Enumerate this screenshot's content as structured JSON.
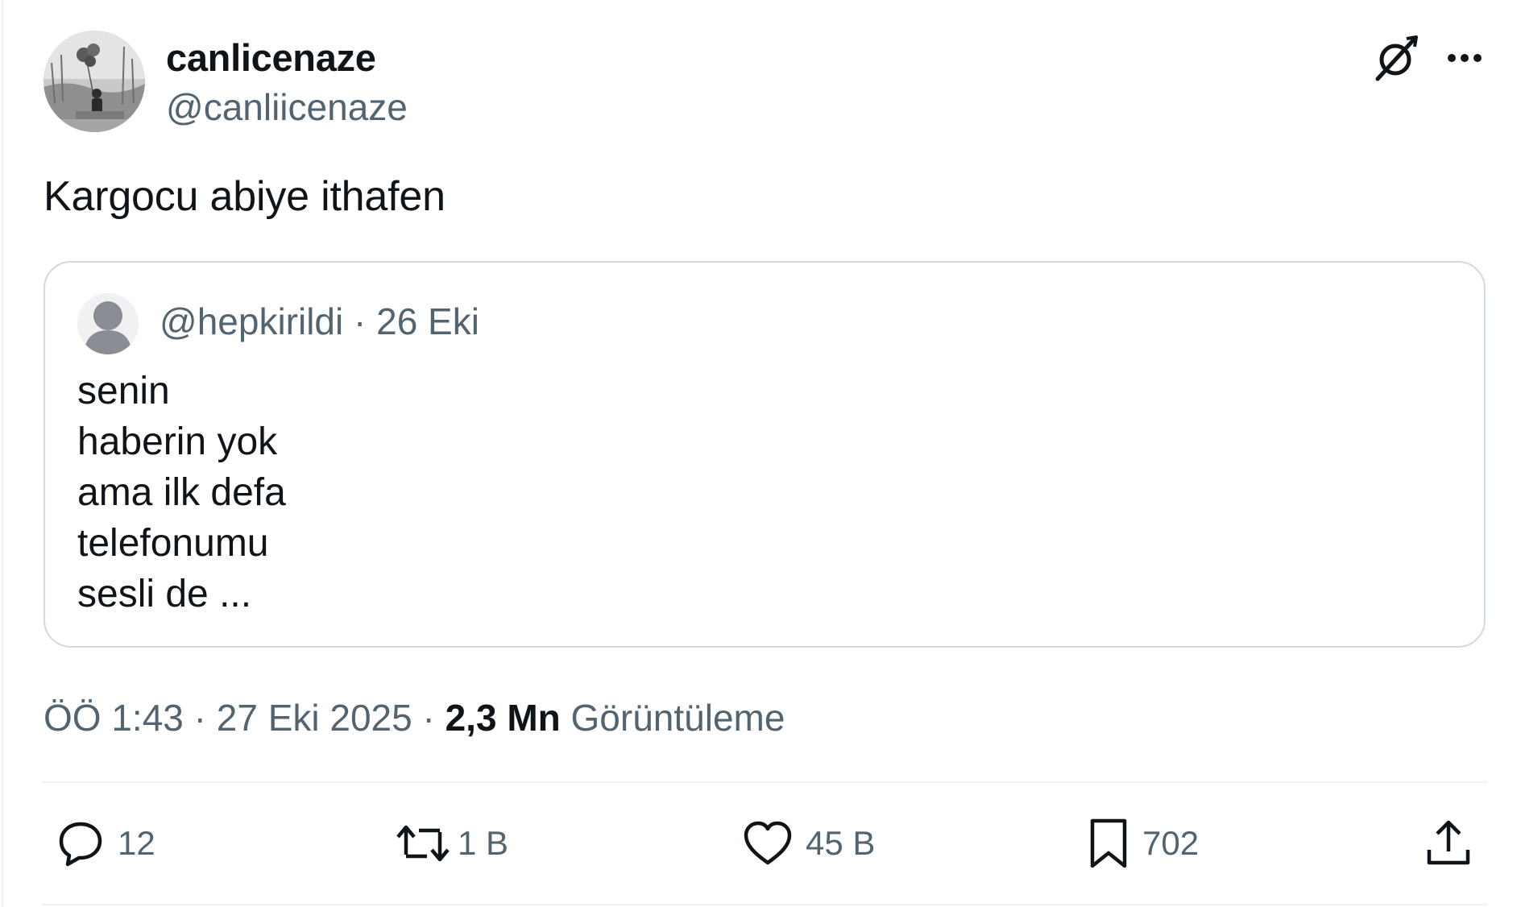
{
  "author": {
    "display_name": "canlicenaze",
    "handle": "@canliicenaze"
  },
  "tweet": {
    "text": "Kargocu abiye ithafen",
    "time": "ÖÖ 1:43 · 27 Eki 2025 · ",
    "views_count": "2,3 Mn",
    "views_label": "Görüntüleme"
  },
  "quote": {
    "handle": "@hepkirildi",
    "date": " · 26 Eki",
    "lines": [
      "senin",
      "haberin yok",
      "ama ilk defa",
      "telefonumu",
      "sesli de ..."
    ]
  },
  "actions": {
    "replies": "12",
    "reposts": "1 B",
    "likes": "45 B",
    "bookmarks": "702"
  },
  "icons": {
    "grok": "grok-icon",
    "more": "more-icon",
    "reply": "reply-icon",
    "repost": "repost-icon",
    "like": "heart-icon",
    "bookmark": "bookmark-icon",
    "share": "share-icon"
  },
  "colors": {
    "text_primary": "#0f1419",
    "text_secondary": "#536471",
    "border": "#cfd9de"
  }
}
